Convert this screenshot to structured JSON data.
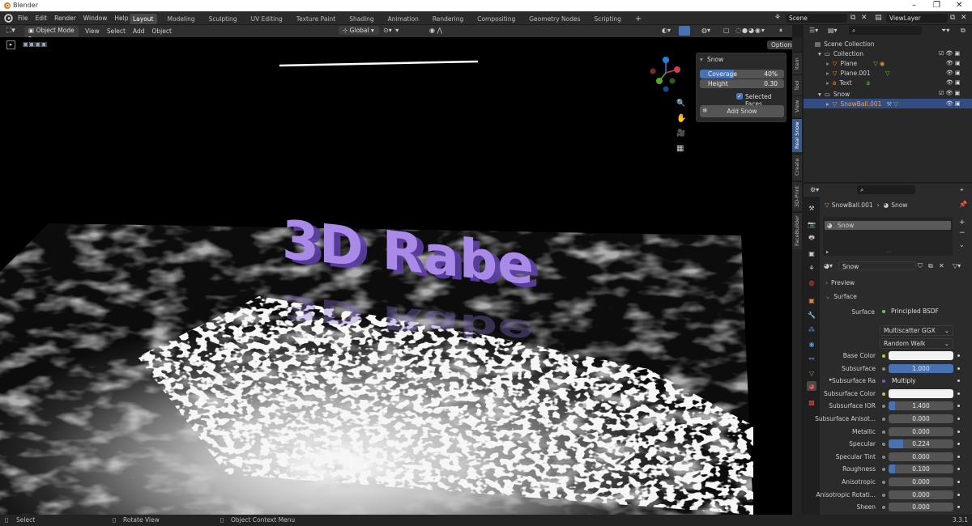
{
  "window": {
    "title": "Blender"
  },
  "menu": [
    "File",
    "Edit",
    "Render",
    "Window",
    "Help"
  ],
  "workspaces": [
    "Layout",
    "Modeling",
    "Sculpting",
    "UV Editing",
    "Texture Paint",
    "Shading",
    "Animation",
    "Rendering",
    "Compositing",
    "Geometry Nodes",
    "Scripting"
  ],
  "active_workspace": "Layout",
  "scene": {
    "name": "Scene",
    "view_layer": "ViewLayer"
  },
  "viewport_header": {
    "mode": "Object Mode",
    "menus": [
      "View",
      "Select",
      "Add",
      "Object"
    ],
    "orientation": "Global"
  },
  "viewport": {
    "options_label": "Options",
    "text_object": "3D Rabe"
  },
  "snow_panel": {
    "title": "Snow",
    "coverage_label": "Coverage",
    "coverage_value": "40%",
    "coverage_fraction": 0.4,
    "height_label": "Height",
    "height_value": "0.30",
    "selected_faces_label": "Selected Faces",
    "selected_faces_checked": true,
    "add_button": "Add Snow"
  },
  "side_tabs": [
    "Item",
    "Tool",
    "View",
    "Real Snow",
    "Create",
    "3D-Print",
    "FaceBuilder"
  ],
  "active_side_tab": "Real Snow",
  "outliner": {
    "rows": [
      {
        "label": "Scene Collection"
      },
      {
        "label": "Collection"
      },
      {
        "label": "Plane"
      },
      {
        "label": "Plane.001"
      },
      {
        "label": "Text"
      },
      {
        "label": "Snow"
      },
      {
        "label": "SnowBall.001"
      }
    ]
  },
  "properties": {
    "breadcrumb_object": "SnowBall.001",
    "breadcrumb_material": "Snow",
    "material_slot": "Snow",
    "material_name": "Snow",
    "preview_label": "Preview",
    "surface_section": "Surface",
    "surface_label": "Surface",
    "surface_shader": "Principled BSDF",
    "distribution": "Multiscatter GGX",
    "subsurface_method": "Random Walk",
    "rows": [
      {
        "label": "Base Color",
        "kind": "color",
        "color": "#f2f2f2"
      },
      {
        "label": "Subsurface",
        "value": "1.000",
        "fill": 1.0
      },
      {
        "label": "Subsurface Ra",
        "value": "Multiply",
        "kind": "socket"
      },
      {
        "label": "Subsurface Color",
        "kind": "color",
        "color": "#f2f2f2"
      },
      {
        "label": "Subsurface IOR",
        "value": "1.400",
        "fill": 0.1
      },
      {
        "label": "Subsurface Anisot...",
        "value": "0.000",
        "fill": 0
      },
      {
        "label": "Metallic",
        "value": "0.000",
        "fill": 0
      },
      {
        "label": "Specular",
        "value": "0.224",
        "fill": 0.224
      },
      {
        "label": "Specular Tint",
        "value": "0.000",
        "fill": 0
      },
      {
        "label": "Roughness",
        "value": "0.100",
        "fill": 0.1
      },
      {
        "label": "Anisotropic",
        "value": "0.000",
        "fill": 0
      },
      {
        "label": "Anisotropic Rotati...",
        "value": "0.000",
        "fill": 0
      },
      {
        "label": "Sheen",
        "value": "0.000",
        "fill": 0
      }
    ]
  },
  "status": {
    "select": "Select",
    "rotate": "Rotate View",
    "context": "Object Context Menu",
    "version": "3.3.1"
  },
  "colors": {
    "accent": "#4772b3",
    "selection": "#334d80",
    "text_purple": "#a98ae8"
  }
}
